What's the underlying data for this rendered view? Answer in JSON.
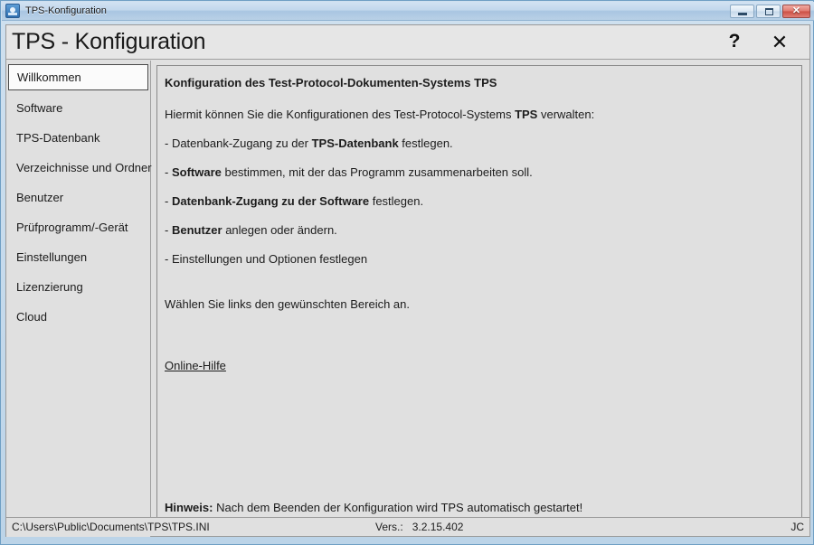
{
  "window": {
    "titlebar_text": "TPS-Konfiguration",
    "icon": "app-icon",
    "buttons": {
      "minimize": "minimize-icon",
      "maximize": "maximize-icon",
      "close": "✕"
    }
  },
  "header": {
    "title": "TPS - Konfiguration",
    "help_label": "?",
    "close_label": "✕"
  },
  "sidebar": {
    "items": [
      {
        "label": "Willkommen",
        "selected": true
      },
      {
        "label": "Software",
        "selected": false
      },
      {
        "label": "TPS-Datenbank",
        "selected": false
      },
      {
        "label": "Verzeichnisse und Ordner",
        "selected": false
      },
      {
        "label": "Benutzer",
        "selected": false
      },
      {
        "label": "Prüfprogramm/-Gerät",
        "selected": false
      },
      {
        "label": "Einstellungen",
        "selected": false
      },
      {
        "label": "Lizenzierung",
        "selected": false
      },
      {
        "label": "Cloud",
        "selected": false
      }
    ]
  },
  "content": {
    "heading": "Konfiguration des Test-Protocol-Dokumenten-Systems TPS",
    "intro_before": "Hiermit können Sie die Konfigurationen des Test-Protocol-Systems ",
    "intro_bold": "TPS",
    "intro_after": " verwalten:",
    "bullets": [
      {
        "prefix": "- Datenbank-Zugang zu der ",
        "bold": "TPS-Datenbank",
        "suffix": " festlegen."
      },
      {
        "prefix": "- ",
        "bold": "Software",
        "suffix": " bestimmen, mit der das Programm zusammenarbeiten soll."
      },
      {
        "prefix": "- ",
        "bold": "Datenbank-Zugang zu der Software",
        "suffix": " festlegen."
      },
      {
        "prefix": "- ",
        "bold": "Benutzer",
        "suffix": " anlegen oder ändern."
      },
      {
        "prefix": "- Einstellungen und Optionen festlegen",
        "bold": "",
        "suffix": ""
      }
    ],
    "instruction": "Wählen Sie links den gewünschten Bereich an.",
    "help_link": "Online-Hilfe",
    "note_bold": "Hinweis:",
    "note_text": " Nach dem Beenden der Konfiguration wird TPS automatisch gestartet!"
  },
  "statusbar": {
    "path": "C:\\Users\\Public\\Documents\\TPS\\TPS.INI",
    "version_label": "Vers.:",
    "version_value": "3.2.15.402",
    "user": "JC"
  },
  "colors": {
    "window_frame": "#bcd4e8",
    "client_bg": "#e0e0e0",
    "selected_bg": "#fbfbfb",
    "close_red": "#cc4f43"
  }
}
